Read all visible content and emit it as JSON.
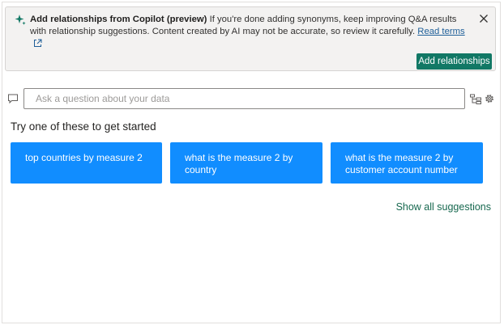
{
  "banner": {
    "title": "Add relationships from Copilot (preview)",
    "message": "If you're done adding synonyms, keep improving Q&A results with relationship suggestions. Content created by AI may not be accurate, so review it carefully.",
    "link_label": "Read terms",
    "action_label": "Add relationships",
    "icons": [
      "copilot-sparkle-icon",
      "external-link-icon",
      "close-icon"
    ],
    "action_color": "#117865"
  },
  "qa": {
    "placeholder": "Ask a question about your data",
    "value": "",
    "icons": [
      "chat-bubble-icon",
      "tree-view-icon",
      "gear-icon"
    ]
  },
  "suggestions": {
    "heading": "Try one of these to get started",
    "items": [
      "top countries by measure 2",
      "what is the measure 2 by country",
      "what is the measure 2 by customer account number"
    ],
    "color": "#118dff",
    "show_all_label": "Show all suggestions"
  }
}
